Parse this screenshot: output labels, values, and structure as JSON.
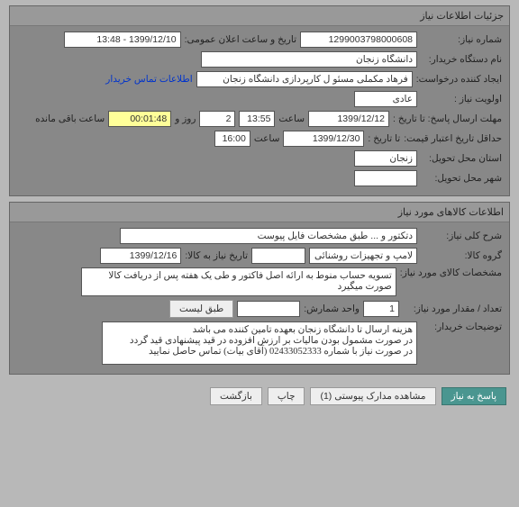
{
  "section1": {
    "title": "جزئیات اطلاعات نیاز",
    "req_no_label": "شماره نیاز:",
    "req_no": "1299003798000608",
    "pub_label": "تاریخ و ساعت اعلان عمومی:",
    "pub_value": "1399/12/10 - 13:48",
    "org_label": "نام دستگاه خریدار:",
    "org_value": "دانشگاه زنجان",
    "creator_label": "ایجاد کننده درخواست:",
    "creator_value": "فرهاد مکملی مسئو ل کارپردازی دانشگاه زنجان",
    "contact_link": "اطلاعات تماس خریدار",
    "priority_label": "اولویت نیاز :",
    "priority_value": "عادی",
    "deadline_label": "مهلت ارسال پاسخ:  تا تاریخ :",
    "deadline_date": "1399/12/12",
    "time_label": "ساعت",
    "deadline_time": "13:55",
    "days_value": "2",
    "days_label": "روز و",
    "remaining_time": "00:01:48",
    "remaining_label": "ساعت باقی مانده",
    "valid_label": "حداقل تاریخ اعتبار قیمت:",
    "valid_to": "تا تاریخ :",
    "valid_date": "1399/12/30",
    "valid_time": "16:00",
    "province_label": "استان محل تحویل:",
    "province_value": "زنجان",
    "city_label": "شهر محل تحویل:",
    "city_value": ""
  },
  "section2": {
    "title": "اطلاعات کالاهای مورد نیاز",
    "desc_label": "شرح کلی نیاز:",
    "desc_value": "دتکتور و ... طبق مشخصات فایل پیوست",
    "group_label": "گروه کالا:",
    "group_value": "لامپ و تجهیزات روشنائی",
    "id_label": "",
    "id_value": "",
    "item_date_label": "تاریخ نیاز به کالا:",
    "item_date": "1399/12/16",
    "spec_label": "مشخصات کالای مورد نیاز:",
    "spec_value": "تسویه حساب منوط به ارائه اصل فاکتور و طی یک هفته پس از دریافت کالا صورت میگیرد",
    "qty_label": "تعداد / مقدار مورد نیاز:",
    "qty_value": "1",
    "unit_label": "واحد شمارش:",
    "unit_value": "",
    "list_btn": "طبق لیست",
    "notes_label": "توضیحات خریدار:",
    "notes_value": "هزینه ارسال تا دانشگاه زنجان بعهده تامین کننده می باشد\nدر صورت مشمول بودن مالیات بر ارزش افزوده در قید پیشنهادی قید گردد\nدر صورت نیاز با شماره 02433052333 (آقای بیات) تماس حاصل نمایید"
  },
  "buttons": {
    "reply": "پاسخ به نیاز",
    "attachments": "مشاهده مدارک پیوستی (1)",
    "print": "چاپ",
    "back": "بازگشت"
  }
}
